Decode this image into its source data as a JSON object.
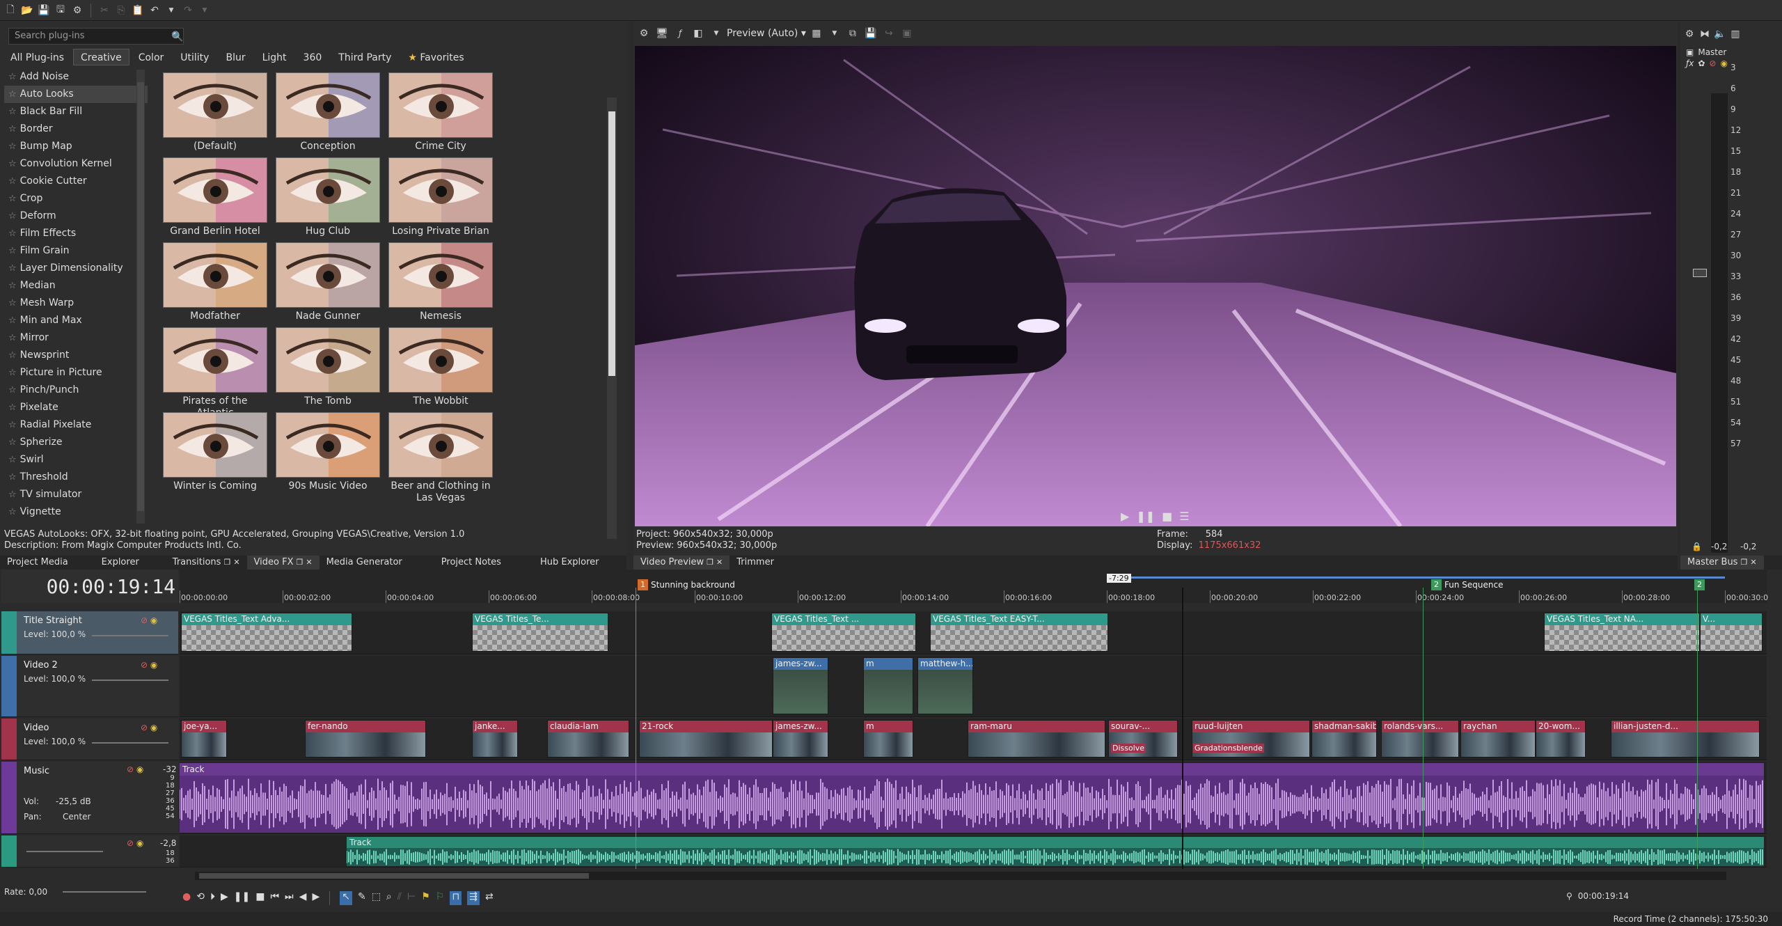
{
  "plugins": {
    "search_placeholder": "Search plug-ins",
    "tabs": [
      "All Plug-ins",
      "Creative",
      "Color",
      "Utility",
      "Blur",
      "Light",
      "360",
      "Third Party",
      "Favorites"
    ],
    "items": [
      "Add Noise",
      "Auto Looks",
      "Black Bar Fill",
      "Border",
      "Bump Map",
      "Convolution Kernel",
      "Cookie Cutter",
      "Crop",
      "Deform",
      "Film Effects",
      "Film Grain",
      "Layer Dimensionality",
      "Median",
      "Mesh Warp",
      "Min and Max",
      "Mirror",
      "Newsprint",
      "Picture in Picture",
      "Pinch/Punch",
      "Pixelate",
      "Radial Pixelate",
      "Spherize",
      "Swirl",
      "Threshold",
      "TV simulator",
      "Vignette"
    ],
    "presets": [
      "(Default)",
      "Conception",
      "Crime City",
      "Grand Berlin Hotel",
      "Hug Club",
      "Losing Private Brian",
      "Modfather",
      "Nade Gunner",
      "Nemesis",
      "Pirates of the Atlantic",
      "The Tomb",
      "The Wobbit",
      "Winter is Coming",
      "90s Music Video",
      "Beer and Clothing in Las Vegas"
    ],
    "info_line1": "VEGAS AutoLooks: OFX, 32-bit floating point, GPU Accelerated, Grouping VEGAS\\Creative, Version 1.0",
    "info_line2": "Description: From Magix Computer Products Intl. Co."
  },
  "dock_left": [
    "Project Media",
    "Explorer",
    "Transitions",
    "Video FX",
    "Media Generator",
    "Project Notes",
    "Hub Explorer"
  ],
  "preview": {
    "mode": "Preview (Auto)",
    "project": "Project:   960x540x32; 30,000p",
    "preview": "Preview:  960x540x32; 30,000p",
    "frame_label": "Frame:",
    "frame_value": "584",
    "display_label": "Display:",
    "display_value": "1175x661x32",
    "tabs": [
      "Video Preview",
      "Trimmer"
    ]
  },
  "master": {
    "label": "Master",
    "ticks": [
      "3",
      "6",
      "9",
      "12",
      "15",
      "18",
      "21",
      "24",
      "27",
      "30",
      "33",
      "36",
      "39",
      "42",
      "45",
      "48",
      "51",
      "54",
      "57"
    ],
    "peak_left": "-0,2",
    "peak_right": "-0,2",
    "tab": "Master Bus"
  },
  "timeline": {
    "timecode": "00:00:19:14",
    "markers": [
      {
        "num": "1",
        "label": "Stunning backround"
      },
      {
        "num": "2",
        "label": "Fun Sequence"
      },
      {
        "num": "2",
        "label": ""
      }
    ],
    "loop_badge": "-7:29",
    "ruler": [
      "00:00:00:00",
      "00:00:02:00",
      "00:00:04:00",
      "00:00:06:00",
      "00:00:08:00",
      "00:00:10:00",
      "00:00:12:00",
      "00:00:14:00",
      "00:00:16:00",
      "00:00:18:00",
      "00:00:20:00",
      "00:00:22:00",
      "00:00:24:00",
      "00:00:26:00",
      "00:00:28:00",
      "00:00:30:0"
    ],
    "tracks": {
      "t1": {
        "name": "Title Straight",
        "level": "Level: 100,0 %"
      },
      "t2": {
        "name": "Video 2",
        "level": "Level: 100,0 %"
      },
      "t3": {
        "name": "Video",
        "level": "Level: 100,0 %"
      },
      "t4": {
        "name": "Music",
        "vol": "Vol:",
        "vol_val": "-25,5 dB",
        "pan": "Pan:",
        "pan_val": "Center",
        "db": "-32",
        "scale": [
          "9",
          "18",
          "27",
          "36",
          "45",
          "54"
        ]
      },
      "t5": {
        "db": "-2,8",
        "scale": [
          "18",
          "36"
        ]
      }
    },
    "clips_title": [
      "VEGAS Titles_Text Adva...",
      "VEGAS Titles_Te...",
      "VEGAS Titles_Text ...",
      "VEGAS Titles_Text EASY-T...",
      "VEGAS Titles_Text NA...",
      "V..."
    ],
    "clips_v2": [
      "james-zw...",
      "m",
      "matthew-h..."
    ],
    "clips_v1": [
      "joe-ya...",
      "fer-nando",
      "janke...",
      "claudia-lam",
      "21-rock",
      "james-zw...",
      "m",
      "ram-maru",
      "sourav-...",
      "ruud-luijten",
      "shadman-sakib",
      "rolands-vars...",
      "raychan",
      "20-wom...",
      "illian-justen-d..."
    ],
    "fx_labels": [
      "Dissolve",
      "Gradationsblende"
    ],
    "audio_track_label": "Track",
    "audio_track2_label": "Track",
    "rate": "Rate: 0,00",
    "cursor_time": "00:00:19:14"
  },
  "status": "Record Time (2 channels): 175:50:30"
}
